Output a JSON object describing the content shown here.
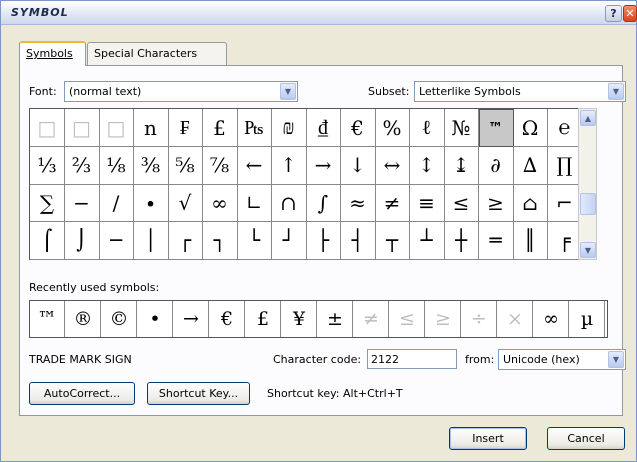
{
  "window": {
    "title": "SYMBOL"
  },
  "titlebar": {
    "help_icon": "help-icon",
    "close_icon": "close-icon",
    "help_glyph": "?",
    "close_glyph": "✕"
  },
  "tabs": [
    {
      "label": "Symbols",
      "active": true
    },
    {
      "label": "Special Characters",
      "active": false
    }
  ],
  "font": {
    "label": "Font:",
    "value": "(normal text)"
  },
  "subset": {
    "label": "Subset:",
    "value": "Letterlike Symbols"
  },
  "symbol_grid": {
    "rows": [
      [
        "□",
        "□",
        "□",
        "n",
        "₣",
        "£",
        "₧",
        "₪",
        "₫",
        "€",
        "%",
        "ℓ",
        "№",
        "™",
        "Ω",
        "℮"
      ],
      [
        "⅓",
        "⅔",
        "⅛",
        "⅜",
        "⅝",
        "⅞",
        "←",
        "↑",
        "→",
        "↓",
        "↔",
        "↕",
        "↨",
        "∂",
        "∆",
        "∏"
      ],
      [
        "∑",
        "−",
        "∕",
        "∙",
        "√",
        "∞",
        "∟",
        "∩",
        "∫",
        "≈",
        "≠",
        "≡",
        "≤",
        "≥",
        "⌂",
        "⌐"
      ],
      [
        "⌠",
        "⌡",
        "─",
        "│",
        "┌",
        "┐",
        "└",
        "┘",
        "├",
        "┤",
        "┬",
        "┴",
        "┼",
        "═",
        "║",
        "╒"
      ]
    ],
    "selected": {
      "row": 0,
      "col": 13
    }
  },
  "recent": {
    "label": "Recently used symbols:",
    "symbols": [
      "™",
      "®",
      "©",
      "•",
      "→",
      "€",
      "£",
      "¥",
      "±",
      "≠",
      "≤",
      "≥",
      "÷",
      "×",
      "∞",
      "µ"
    ]
  },
  "char_name": "TRADE MARK SIGN",
  "char_code": {
    "label": "Character code:",
    "value": "2122"
  },
  "from": {
    "label": "from:",
    "value": "Unicode (hex)"
  },
  "buttons": {
    "autocorrect": "AutoCorrect...",
    "shortcut_key": "Shortcut Key...",
    "insert": "Insert",
    "cancel": "Cancel"
  },
  "shortcut_text": "Shortcut key: Alt+Ctrl+T"
}
